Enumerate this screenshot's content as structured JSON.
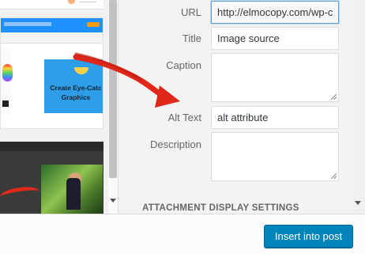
{
  "media_grid": {
    "thumb2_caption": "Create Eye-Catc Graphics"
  },
  "details": {
    "url_label": "URL",
    "url_value": "http://elmocopy.com/wp-c",
    "title_label": "Title",
    "title_value": "Image source",
    "caption_label": "Caption",
    "caption_value": "",
    "alt_label": "Alt Text",
    "alt_value": "alt attribute",
    "description_label": "Description",
    "description_value": "",
    "section_heading": "ATTACHMENT DISPLAY SETTINGS"
  },
  "footer": {
    "insert_label": "Insert into post"
  },
  "annotation": {
    "arrow_color": "#e0281a"
  },
  "colors": {
    "primary_button": "#0085ba",
    "panel_bg": "#f3f3f3"
  }
}
